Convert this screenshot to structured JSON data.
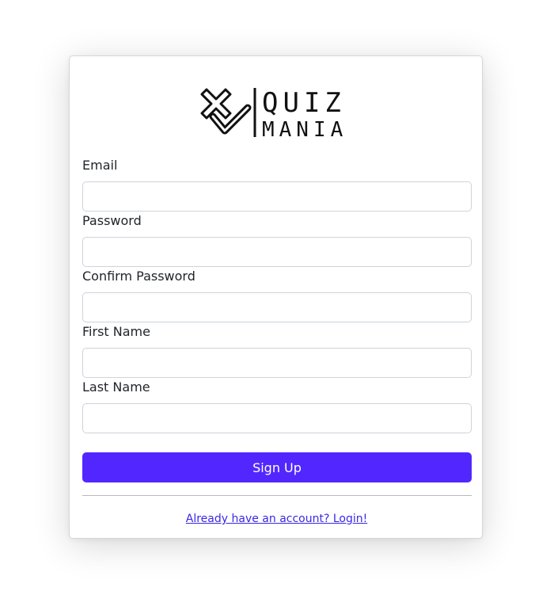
{
  "logo": {
    "top_word": "QUIZ",
    "bottom_word": "MANIA",
    "icon": "x-check-icon"
  },
  "form": {
    "fields": [
      {
        "label": "Email",
        "value": "",
        "placeholder": ""
      },
      {
        "label": "Password",
        "value": "",
        "placeholder": ""
      },
      {
        "label": "Confirm Password",
        "value": "",
        "placeholder": ""
      },
      {
        "label": "First Name",
        "value": "",
        "placeholder": ""
      },
      {
        "label": "Last Name",
        "value": "",
        "placeholder": ""
      }
    ],
    "submit_label": "Sign Up",
    "login_link": "Already have an account? Login!"
  },
  "colors": {
    "accent": "#5227ff",
    "link": "#3a27e6"
  }
}
